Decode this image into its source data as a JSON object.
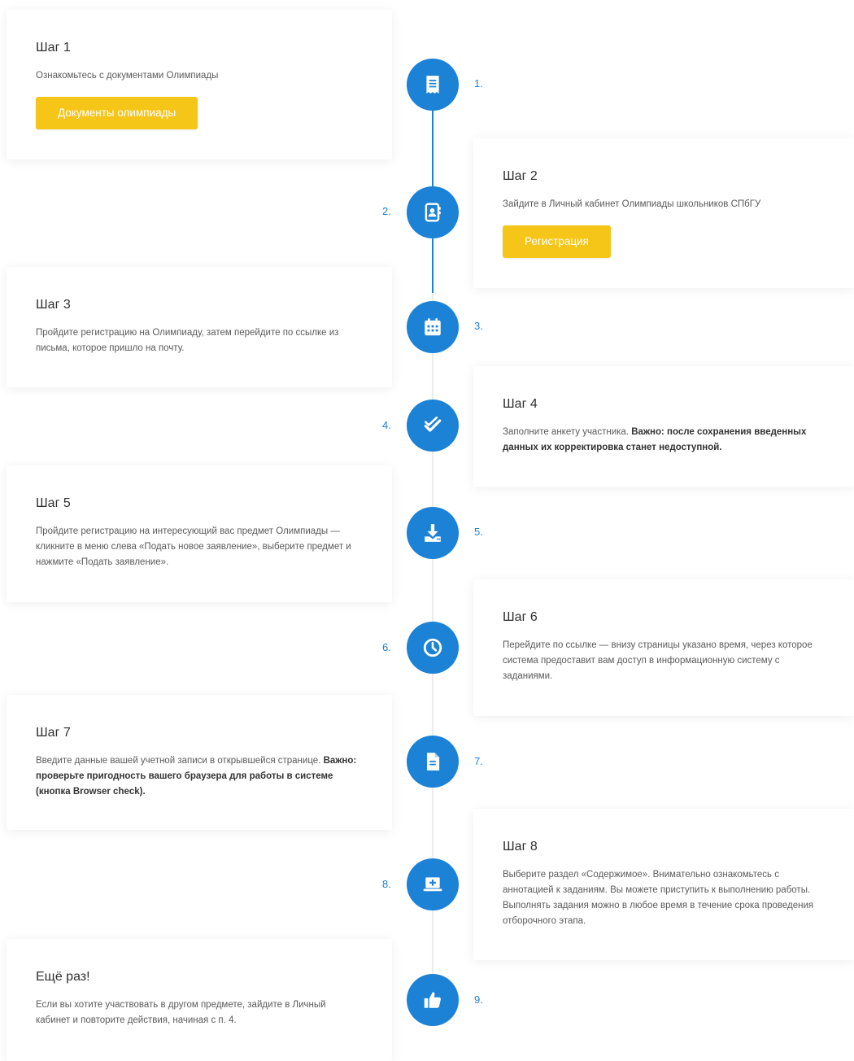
{
  "steps": [
    {
      "number": "1.",
      "title": "Шаг 1",
      "text": "Ознакомьтесь с документами Олимпиады",
      "button": "Документы олимпиады",
      "icon": "receipt-icon"
    },
    {
      "number": "2.",
      "title": "Шаг 2",
      "text": "Зайдите в Личный кабинет Олимпиады школьников СПбГУ",
      "button": "Регистрация",
      "icon": "contact-book-icon"
    },
    {
      "number": "3.",
      "title": "Шаг 3",
      "text": "Пройдите регистрацию на Олимпиаду, затем перейдите по ссылке из письма, которое пришло на почту.",
      "icon": "calendar-icon"
    },
    {
      "number": "4.",
      "title": "Шаг 4",
      "text": "Заполните анкету участника. ",
      "bold": "Важно: после сохранения введенных данных их корректировка станет недоступной.",
      "icon": "double-check-icon"
    },
    {
      "number": "5.",
      "title": "Шаг 5",
      "text": "Пройдите регистрацию на интересующий вас предмет Олимпиады — кликните в меню слева «Подать новое заявление», выберите предмет и нажмите «Подать заявление».",
      "icon": "download-icon"
    },
    {
      "number": "6.",
      "title": "Шаг 6",
      "text": "Перейдите по ссылке — внизу страницы указано время, через которое система предоставит вам доступ в информационную систему с заданиями.",
      "icon": "clock-icon"
    },
    {
      "number": "7.",
      "title": "Шаг 7",
      "text": "Введите данные вашей учетной записи в открывшейся странице. ",
      "bold": "Важно: проверьте пригодность вашего браузера для работы в системе (кнопка Browser check).",
      "icon": "document-icon"
    },
    {
      "number": "8.",
      "title": "Шаг 8",
      "text": "Выберите раздел «Содержимое». Внимательно ознакомьтесь с аннотацией к заданиям. Вы можете приступить к выполнению работы. Выполнять задания можно в любое время в течение срока проведения отборочного этапа.",
      "icon": "laptop-plus-icon"
    },
    {
      "number": "9.",
      "title": "Ещё раз!",
      "text": "Если вы хотите участвовать в другом предмете, зайдите в Личный кабинет и повторите действия, начиная с п. 4.",
      "icon": "thumbs-up-icon"
    }
  ],
  "colors": {
    "accent": "#1c82d6",
    "button": "#f5c518"
  }
}
